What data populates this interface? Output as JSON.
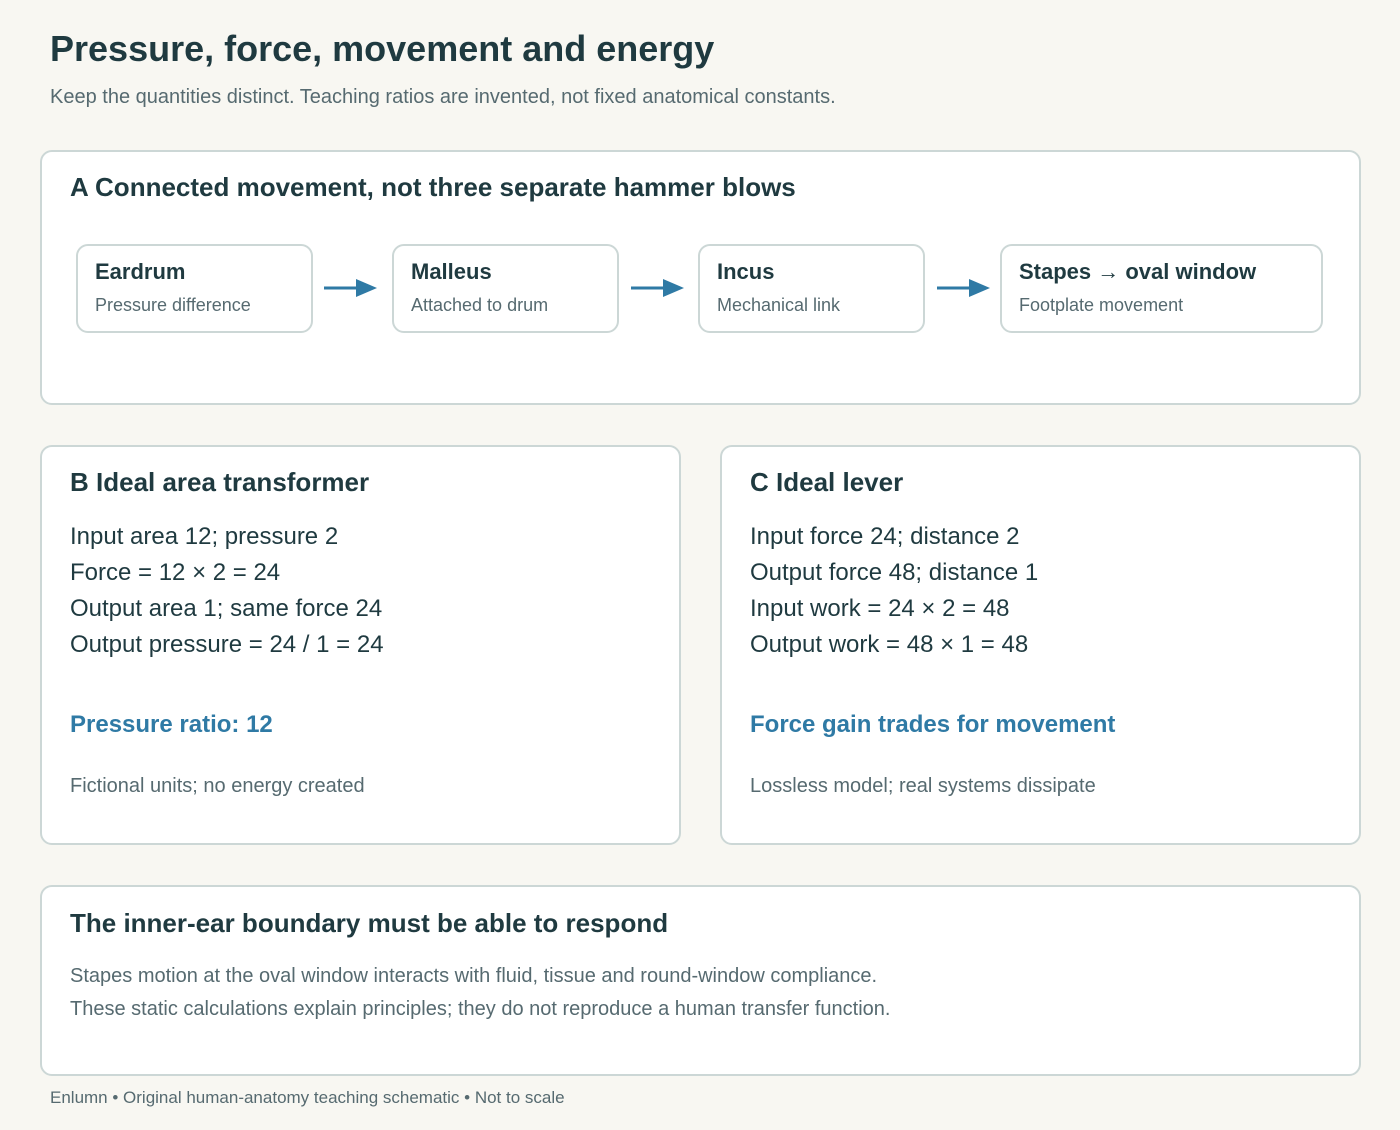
{
  "header": {
    "title": "Pressure, force, movement and energy",
    "subtitle": "Keep the quantities distinct. Teaching ratios are invented, not fixed anatomical constants."
  },
  "panel_a": {
    "title": "A Connected movement, not three separate hammer blows",
    "chain": [
      {
        "label": "Eardrum",
        "description": "Pressure difference"
      },
      {
        "label": "Malleus",
        "description": "Attached to drum"
      },
      {
        "label": "Incus",
        "description": "Mechanical link"
      },
      {
        "label": "Stapes → oval window",
        "description": "Footplate movement"
      }
    ],
    "arrow_color": "#2f7aa5"
  },
  "panel_b": {
    "title": "B Ideal area transformer",
    "lines": [
      "Input area 12; pressure 2",
      "Force = 12 × 2 = 24",
      "Output area 1; same force 24",
      "Output pressure = 24 / 1 = 24"
    ],
    "highlight": "Pressure ratio: 12",
    "note": "Fictional units; no energy created"
  },
  "panel_c": {
    "title": "C Ideal lever",
    "lines": [
      "Input force 24; distance 2",
      "Output force 48; distance 1",
      "Input work = 24 × 2 = 48",
      "Output work = 48 × 1 = 48"
    ],
    "highlight": "Force gain trades for movement",
    "note": "Lossless model; real systems dissipate"
  },
  "panel_d": {
    "title": "The inner-ear boundary must be able to respond",
    "lines": [
      "Stapes motion at the oval window interacts with fluid, tissue and round-window compliance.",
      "These static calculations explain principles; they do not reproduce a human transfer function."
    ]
  },
  "footer": {
    "text": "Enlumn • Original human-anatomy teaching schematic • Not to scale"
  },
  "colors": {
    "background": "#f8f7f2",
    "heading": "#1f3a40",
    "muted": "#566a70",
    "accent": "#2f7aa5",
    "border": "#ccd7d6"
  }
}
